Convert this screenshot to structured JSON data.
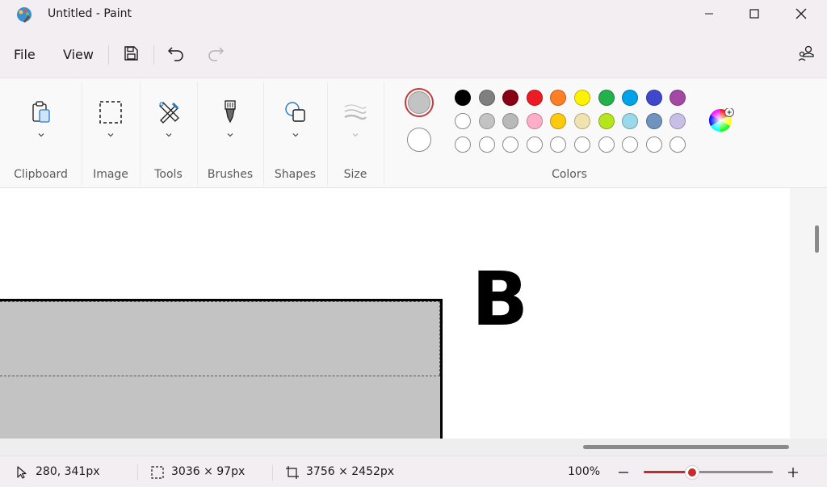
{
  "window": {
    "title": "Untitled - Paint"
  },
  "menu": {
    "file": "File",
    "view": "View"
  },
  "ribbon": {
    "groups": {
      "clipboard": "Clipboard",
      "image": "Image",
      "tools": "Tools",
      "brushes": "Brushes",
      "shapes": "Shapes",
      "size": "Size",
      "colors": "Colors"
    }
  },
  "colors": {
    "primary": "#c3c3c3",
    "secondary": "#ffffff",
    "palette_row1": [
      "#000000",
      "#7f7f7f",
      "#880015",
      "#ed1c24",
      "#ff7f27",
      "#fff200",
      "#22b14c",
      "#00a2e8",
      "#3f48cc",
      "#a349a4"
    ],
    "palette_row2": [
      "#ffffff",
      "#c3c3c3",
      "#b9b9b9",
      "#ffaec9",
      "#ffc90e",
      "#efe4b0",
      "#b5e61d",
      "#99d9ea",
      "#7092be",
      "#c8bfe7"
    ],
    "custom_row_count": 10
  },
  "canvas": {
    "letter": "B",
    "rect_fill": "#c3c3c3"
  },
  "status": {
    "cursor_position": "280, 341px",
    "selection_size": "3036 × 97px",
    "canvas_size": "3756 × 2452px",
    "zoom": "100%",
    "zoom_fraction": 0.375
  },
  "icons": {
    "app": "paint-app-icon",
    "minimize": "minimize-icon",
    "maximize": "maximize-icon",
    "close": "close-icon",
    "save": "save-icon",
    "undo": "undo-icon",
    "redo": "redo-icon",
    "account": "account-icon"
  }
}
